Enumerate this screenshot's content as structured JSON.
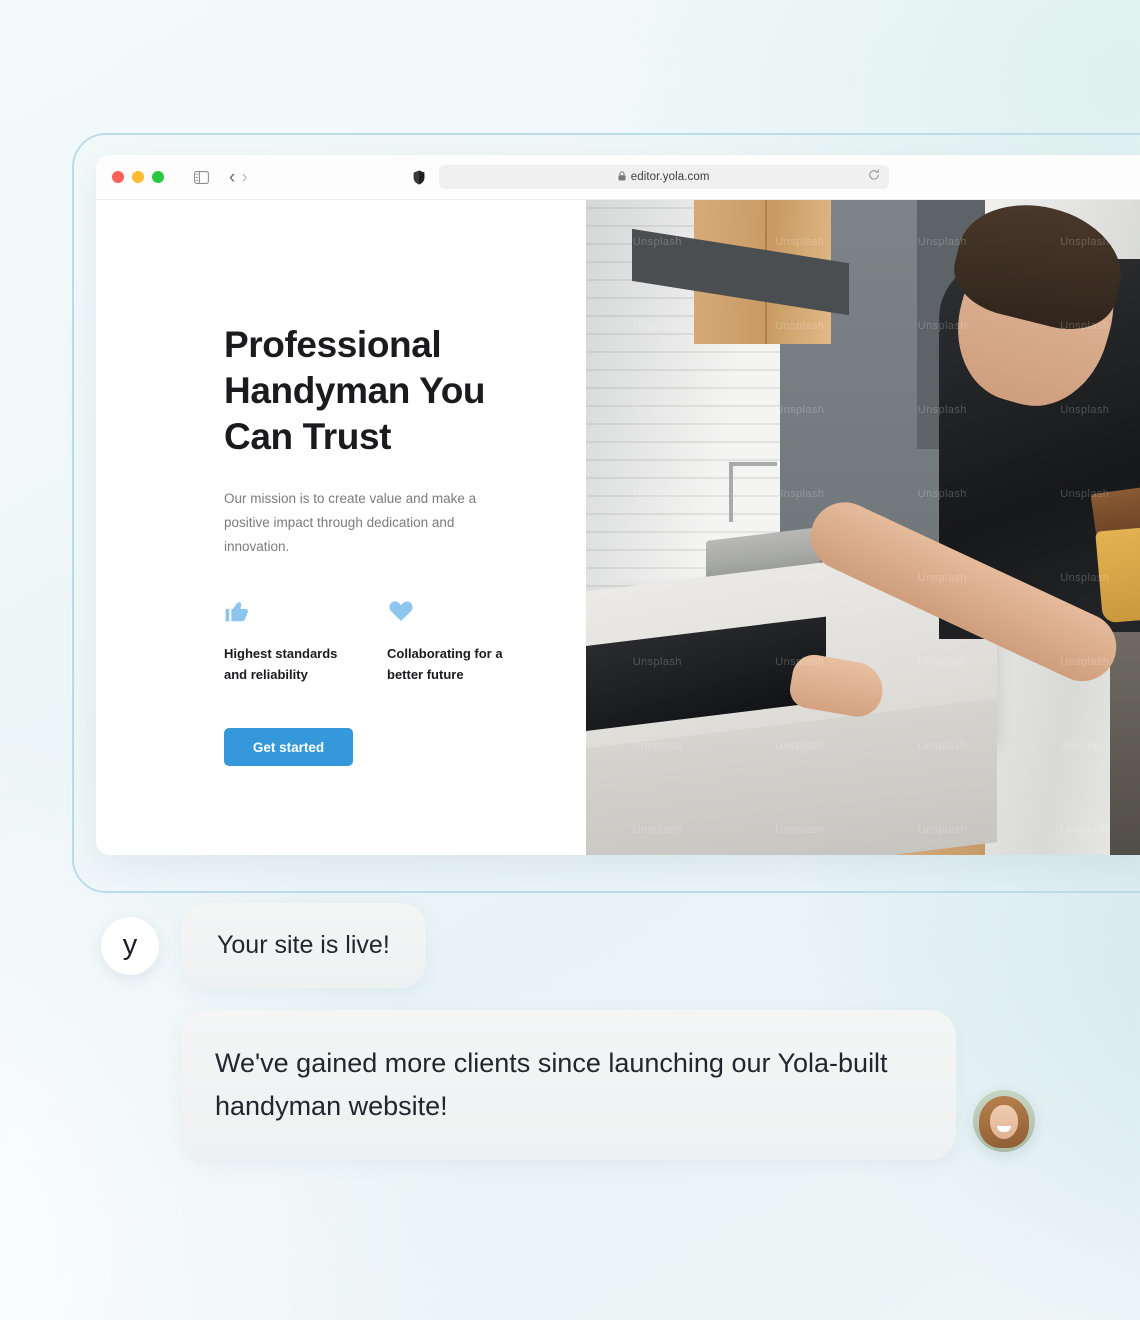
{
  "browser": {
    "traffic_lights": [
      "close",
      "minimize",
      "maximize"
    ],
    "sidebar_icon": "sidebar-toggle-icon",
    "back_label": "‹",
    "forward_label": "›",
    "shield_icon": "shield-icon",
    "lock_icon": "lock-icon",
    "url": "editor.yola.com",
    "reload_icon": "reload-icon"
  },
  "site": {
    "hero": {
      "title": "Professional Handyman You Can Trust",
      "subtitle": "Our mission is to create value and make a positive impact through dedication and innovation.",
      "cta_label": "Get started"
    },
    "features": [
      {
        "icon": "thumbs-up-icon",
        "label": "Highest standards and reliability"
      },
      {
        "icon": "heart-icon",
        "label": "Collaborating for a better future"
      }
    ],
    "photo_alt": "Handyman installing a cooktop in a kitchen",
    "photo_watermark": "Unsplash"
  },
  "chat": {
    "messages": [
      {
        "avatar_letter": "y",
        "text": "Your site is live!"
      },
      {
        "avatar_type": "user-photo",
        "text": "We've gained more clients since launching our Yola-built handyman website!"
      }
    ]
  },
  "colors": {
    "accent_blue": "#3498db",
    "icon_blue": "#8cc6ef",
    "frame_border": "#bcdcea",
    "heading": "#1b1b1f",
    "body_text": "#7b7b80"
  }
}
